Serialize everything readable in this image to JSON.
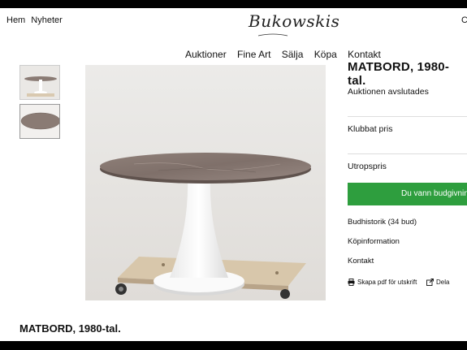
{
  "topnav": {
    "home": "Hem",
    "news": "Nyheter"
  },
  "logo": {
    "text": "Bukowskis"
  },
  "right_glyph": "C",
  "mainnav": [
    "Auktioner",
    "Fine Art",
    "Sälja",
    "Köpa",
    "Kontakt"
  ],
  "product": {
    "title": "MATBORD, 1980-tal.",
    "auction_status": "Auktionen avslutades",
    "hammer_price_label": "Klubbat pris",
    "estimate_label": "Utropspris",
    "win_button": "Du vann budgivning",
    "bid_history": "Budhistorik (34 bud)",
    "purchase_info": "Köpinformation",
    "contact": "Kontakt",
    "pdf_link": "Skapa pdf för utskrift",
    "share_link": "Dela"
  },
  "bottom_title": "MATBORD, 1980-tal.",
  "colors": {
    "button_green": "#2e9e3e",
    "marble": "#8a7b74",
    "pedestal": "#ffffff"
  },
  "icons": [
    "print-icon",
    "share-icon"
  ]
}
